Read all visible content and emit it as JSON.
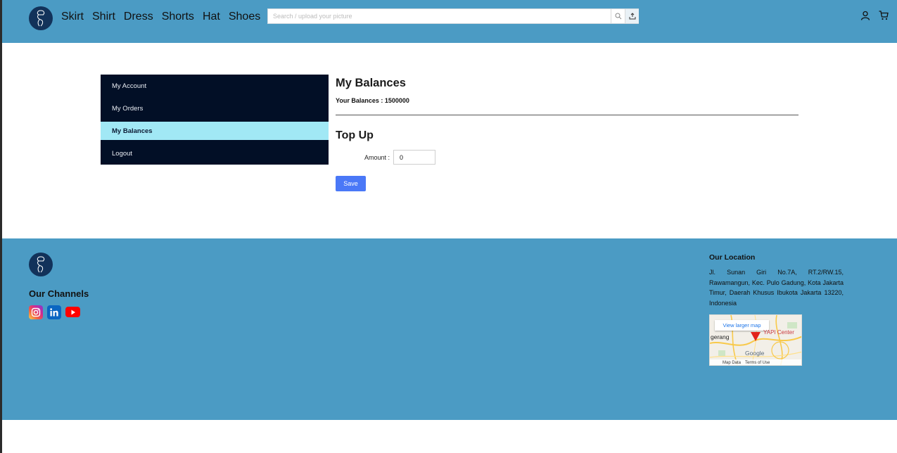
{
  "header": {
    "nav": [
      "Skirt",
      "Shirt",
      "Dress",
      "Shorts",
      "Hat",
      "Shoes"
    ],
    "search_placeholder": "Search / upload your picture",
    "search_icon": "search-icon",
    "upload_icon": "upload-icon",
    "user_icon": "user-icon",
    "cart_icon": "cart-icon",
    "bg_color": "#4b9bc4"
  },
  "sidebar": {
    "items": [
      {
        "label": "My Account",
        "active": false
      },
      {
        "label": "My Orders",
        "active": false
      },
      {
        "label": "My Balances",
        "active": true
      },
      {
        "label": "Logout",
        "active": false
      }
    ],
    "bg_color": "#020f26",
    "active_color": "#a1e8f5"
  },
  "main": {
    "title": "My Balances",
    "balance_text": "Your Balances : 1500000",
    "topup_title": "Top Up",
    "amount_label": "Amount :",
    "amount_value": "0",
    "save_label": "Save",
    "button_color": "#4a78f7"
  },
  "footer": {
    "channels_title": "Our Channels",
    "channels": [
      "instagram-icon",
      "linkedin-icon",
      "youtube-icon"
    ],
    "location_title": "Our Location",
    "address": "Jl. Sunan Giri No.7A, RT.2/RW.15, Rawamangun, Kec. Pulo Gadung, Kota Jakarta Timur, Daerah Khusus Ibukota Jakarta 13220, Indonesia",
    "map": {
      "link": "View larger map",
      "place": "YAPI Center",
      "city": "gerang",
      "brand": "Google",
      "map_data": "Map Data",
      "terms": "Terms of Use"
    }
  }
}
